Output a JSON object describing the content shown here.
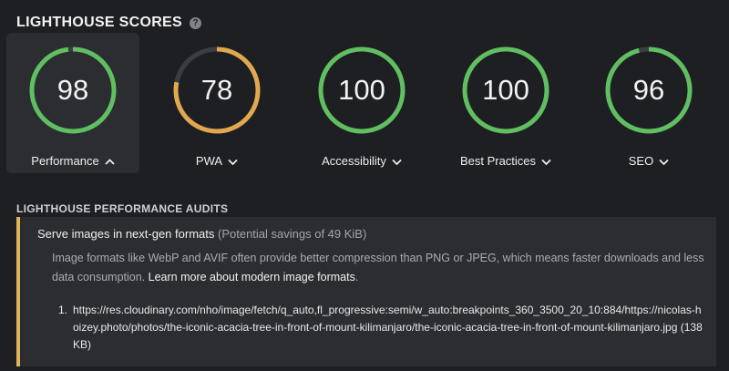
{
  "header": {
    "title": "LIGHTHOUSE SCORES",
    "help_icon": "?"
  },
  "scores": [
    {
      "label": "Performance",
      "value": "98",
      "percent": 98,
      "color": "#5fbf61",
      "expanded": true
    },
    {
      "label": "PWA",
      "value": "78",
      "percent": 78,
      "color": "#e2a84f",
      "expanded": false
    },
    {
      "label": "Accessibility",
      "value": "100",
      "percent": 100,
      "color": "#5fbf61",
      "expanded": false
    },
    {
      "label": "Best Practices",
      "value": "100",
      "percent": 100,
      "color": "#5fbf61",
      "expanded": false
    },
    {
      "label": "SEO",
      "value": "96",
      "percent": 96,
      "color": "#5fbf61",
      "expanded": false
    }
  ],
  "colors": {
    "track": "#3b3d42",
    "warning_border": "#e2b35a"
  },
  "audits": {
    "heading": "LIGHTHOUSE PERFORMANCE AUDITS",
    "title": "Serve images in next-gen formats",
    "savings": "(Potential savings of 49 KiB)",
    "description": "Image formats like WebP and AVIF often provide better compression than PNG or JPEG, which means faster downloads and less data consumption.",
    "learn_more": "Learn more about modern image formats",
    "items": [
      {
        "number": "1.",
        "url": "https://res.cloudinary.com/nho/image/fetch/q_auto,fl_progressive:semi/w_auto:breakpoints_360_3500_20_10:884/https://nicolas-hoizey.photo/photos/the-iconic-acacia-tree-in-front-of-mount-kilimanjaro/the-iconic-acacia-tree-in-front-of-mount-kilimanjaro.jpg",
        "size": "(138KB)"
      }
    ]
  }
}
